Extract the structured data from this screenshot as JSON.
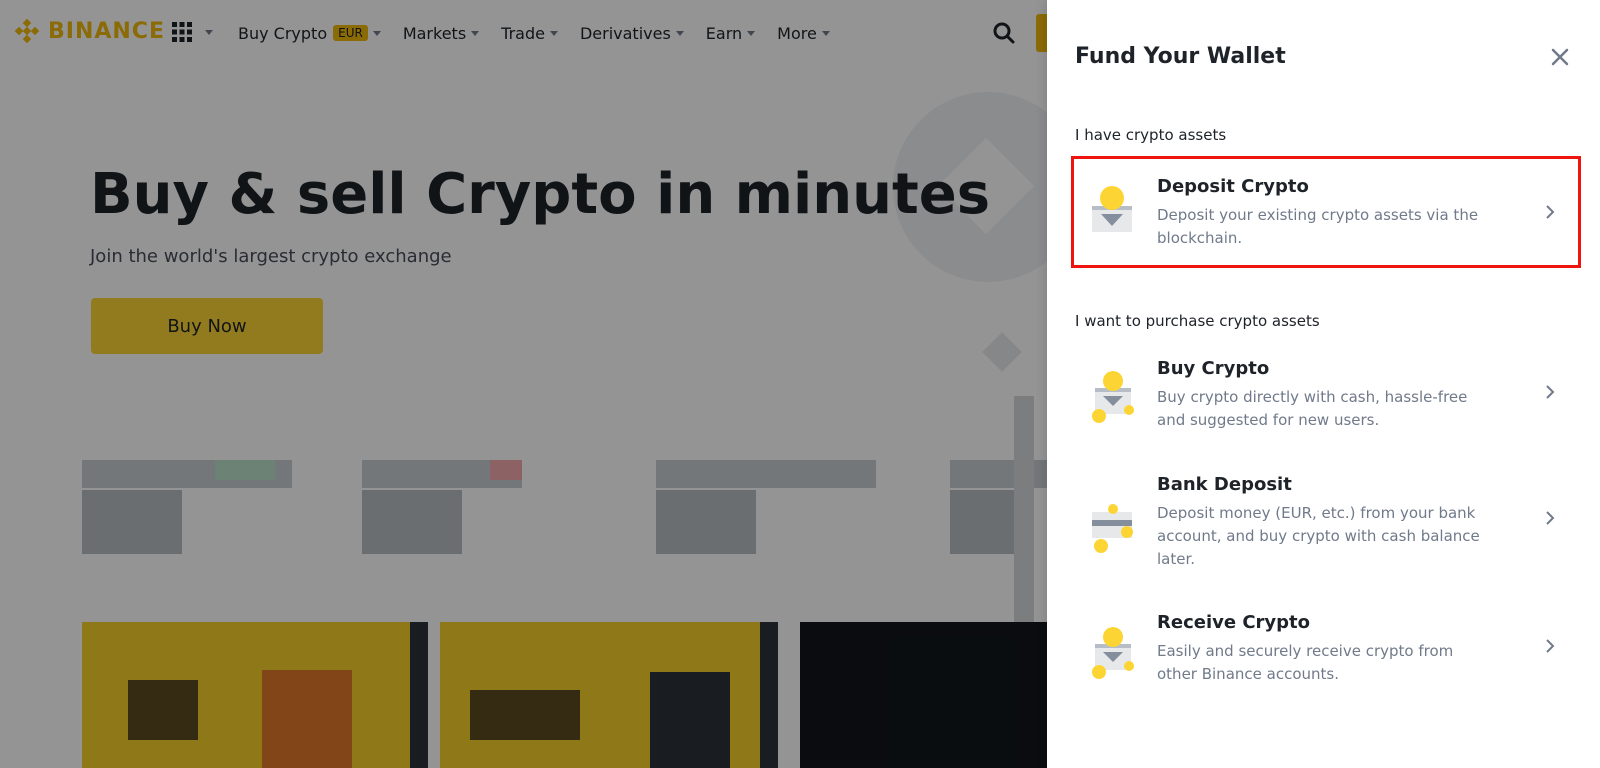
{
  "header": {
    "logo_text": "BINANCE",
    "nav": [
      {
        "label": "Buy Crypto",
        "badge": "EUR"
      },
      {
        "label": "Markets"
      },
      {
        "label": "Trade"
      },
      {
        "label": "Derivatives"
      },
      {
        "label": "Earn"
      },
      {
        "label": "More"
      }
    ],
    "icons": [
      "apps-grid-icon",
      "search-icon"
    ]
  },
  "hero": {
    "title": "Buy & sell Crypto in minutes",
    "subtitle": "Join the world's largest crypto exchange",
    "cta_label": "Buy Now"
  },
  "drawer": {
    "title": "Fund Your Wallet",
    "sections": [
      {
        "label": "I have crypto assets",
        "options": [
          {
            "title": "Deposit Crypto",
            "description": "Deposit your existing crypto assets via the blockchain.",
            "icon": "deposit-crypto-icon",
            "highlighted": true
          }
        ]
      },
      {
        "label": "I want to purchase crypto assets",
        "options": [
          {
            "title": "Buy Crypto",
            "description": "Buy crypto directly with cash, hassle-free and suggested for new users.",
            "icon": "buy-crypto-icon"
          },
          {
            "title": "Bank Deposit",
            "description": "Deposit money (EUR, etc.) from your bank account, and buy crypto with cash balance later.",
            "icon": "bank-deposit-icon"
          },
          {
            "title": "Receive Crypto",
            "description": "Easily and securely receive crypto from other Binance accounts.",
            "icon": "receive-crypto-icon"
          }
        ]
      }
    ]
  },
  "colors": {
    "brand_yellow": "#f0b90b",
    "button_yellow": "#fcd535",
    "highlight_red": "#f0140f",
    "text_primary": "#1e2329",
    "text_secondary": "#707a8a"
  }
}
